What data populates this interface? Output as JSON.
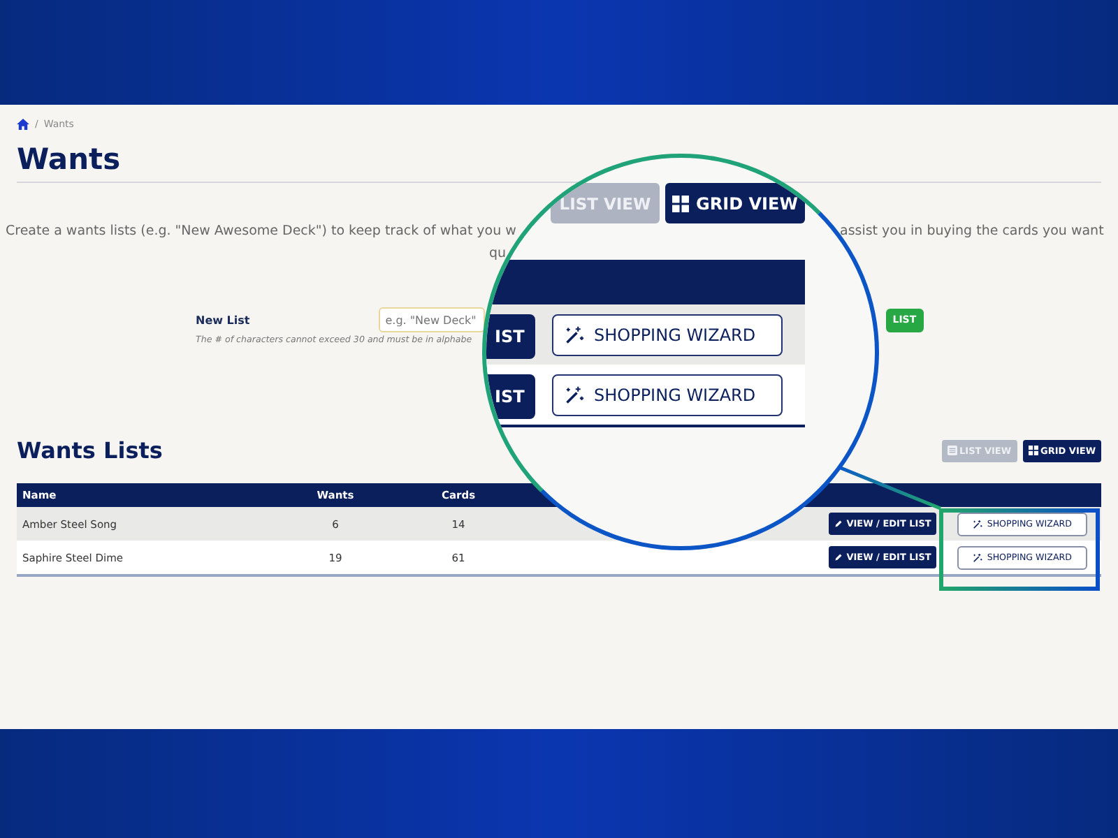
{
  "breadcrumb": {
    "separator": "/",
    "current": "Wants"
  },
  "title": "Wants",
  "description": {
    "line_1_left": "Create a wants lists (e.g. \"New Awesome Deck\") to keep track of what you w",
    "line_1_right": "assist you in buying the cards you want",
    "line_2": "qu"
  },
  "new_list": {
    "label": "New List",
    "placeholder": "e.g. \"New Deck\"",
    "hint": "The # of characters cannot exceed 30 and must be in alphabe",
    "button": "LIST"
  },
  "wants_lists": {
    "title": "Wants Lists",
    "view_buttons": [
      {
        "label": "LIST VIEW",
        "kind": "list",
        "selected": false
      },
      {
        "label": "GRID VIEW",
        "kind": "grid",
        "selected": true
      }
    ],
    "columns": [
      "Name",
      "Wants",
      "Cards"
    ],
    "rows": [
      {
        "name": "Amber Steel Song",
        "wants": "6",
        "cards": "14",
        "edit": "VIEW / EDIT LIST",
        "wizard": "SHOPPING WIZARD"
      },
      {
        "name": "Saphire Steel Dime",
        "wants": "19",
        "cards": "61",
        "edit": "VIEW / EDIT LIST",
        "wizard": "SHOPPING WIZARD"
      }
    ]
  },
  "magnifier": {
    "view_buttons": [
      {
        "label": "LIST VIEW",
        "kind": "list",
        "selected": false
      },
      {
        "label": "GRID VIEW",
        "kind": "grid",
        "selected": true
      }
    ],
    "rows": [
      {
        "edit": "IST",
        "wizard": "SHOPPING WIZARD"
      },
      {
        "edit": "IST",
        "wizard": "SHOPPING WIZARD"
      }
    ]
  }
}
